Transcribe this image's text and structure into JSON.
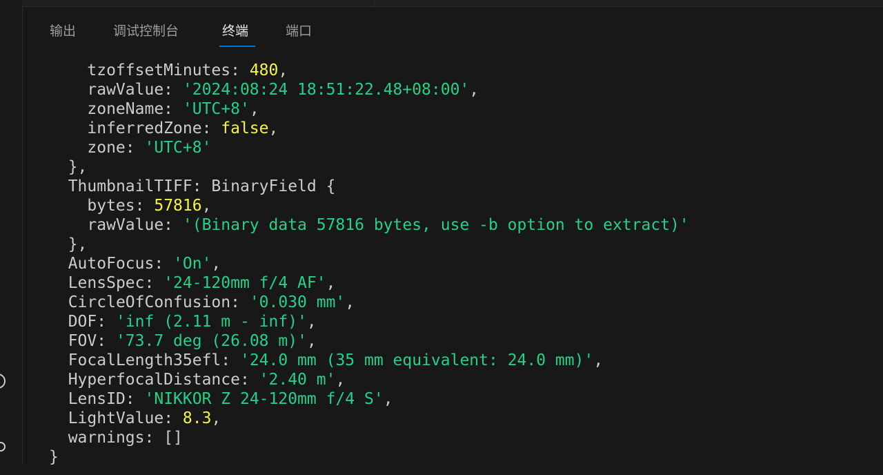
{
  "tabs": [
    {
      "label": "输出",
      "active": false
    },
    {
      "label": "调试控制台",
      "active": false
    },
    {
      "label": "终端",
      "active": true
    },
    {
      "label": "端口",
      "active": false
    }
  ],
  "colors": {
    "string": "#23d18b",
    "number": "#f5f543",
    "text": "#cccccc",
    "accent": "#0078d4"
  },
  "terminal": {
    "lines": [
      {
        "indent": "    ",
        "key": "tzoffsetMinutes",
        "sep": ": ",
        "value": "480",
        "type": "n",
        "tail": ","
      },
      {
        "indent": "    ",
        "key": "rawValue",
        "sep": ": ",
        "value": "'2024:08:24 18:51:22.48+08:00'",
        "type": "s",
        "tail": ","
      },
      {
        "indent": "    ",
        "key": "zoneName",
        "sep": ": ",
        "value": "'UTC+8'",
        "type": "s",
        "tail": ","
      },
      {
        "indent": "    ",
        "key": "inferredZone",
        "sep": ": ",
        "value": "false",
        "type": "n",
        "tail": ","
      },
      {
        "indent": "    ",
        "key": "zone",
        "sep": ": ",
        "value": "'UTC+8'",
        "type": "s",
        "tail": ""
      },
      {
        "indent": "  ",
        "key": "},",
        "sep": "",
        "value": "",
        "type": "p",
        "tail": ""
      },
      {
        "indent": "  ",
        "key": "ThumbnailTIFF",
        "sep": ": ",
        "value": "BinaryField {",
        "type": "p",
        "tail": ""
      },
      {
        "indent": "    ",
        "key": "bytes",
        "sep": ": ",
        "value": "57816",
        "type": "n",
        "tail": ","
      },
      {
        "indent": "    ",
        "key": "rawValue",
        "sep": ": ",
        "value": "'(Binary data 57816 bytes, use -b option to extract)'",
        "type": "s",
        "tail": ""
      },
      {
        "indent": "  ",
        "key": "},",
        "sep": "",
        "value": "",
        "type": "p",
        "tail": ""
      },
      {
        "indent": "  ",
        "key": "AutoFocus",
        "sep": ": ",
        "value": "'On'",
        "type": "s",
        "tail": ","
      },
      {
        "indent": "  ",
        "key": "LensSpec",
        "sep": ": ",
        "value": "'24-120mm f/4 AF'",
        "type": "s",
        "tail": ","
      },
      {
        "indent": "  ",
        "key": "CircleOfConfusion",
        "sep": ": ",
        "value": "'0.030 mm'",
        "type": "s",
        "tail": ","
      },
      {
        "indent": "  ",
        "key": "DOF",
        "sep": ": ",
        "value": "'inf (2.11 m - inf)'",
        "type": "s",
        "tail": ","
      },
      {
        "indent": "  ",
        "key": "FOV",
        "sep": ": ",
        "value": "'73.7 deg (26.08 m)'",
        "type": "s",
        "tail": ","
      },
      {
        "indent": "  ",
        "key": "FocalLength35efl",
        "sep": ": ",
        "value": "'24.0 mm (35 mm equivalent: 24.0 mm)'",
        "type": "s",
        "tail": ","
      },
      {
        "indent": "  ",
        "key": "HyperfocalDistance",
        "sep": ": ",
        "value": "'2.40 m'",
        "type": "s",
        "tail": ","
      },
      {
        "indent": "  ",
        "key": "LensID",
        "sep": ": ",
        "value": "'NIKKOR Z 24-120mm f/4 S'",
        "type": "s",
        "tail": ","
      },
      {
        "indent": "  ",
        "key": "LightValue",
        "sep": ": ",
        "value": "8.3",
        "type": "n",
        "tail": ","
      },
      {
        "indent": "  ",
        "key": "warnings",
        "sep": ": ",
        "value": "[]",
        "type": "p",
        "tail": ""
      },
      {
        "indent": "",
        "key": "}",
        "sep": "",
        "value": "",
        "type": "p",
        "tail": ""
      }
    ]
  }
}
